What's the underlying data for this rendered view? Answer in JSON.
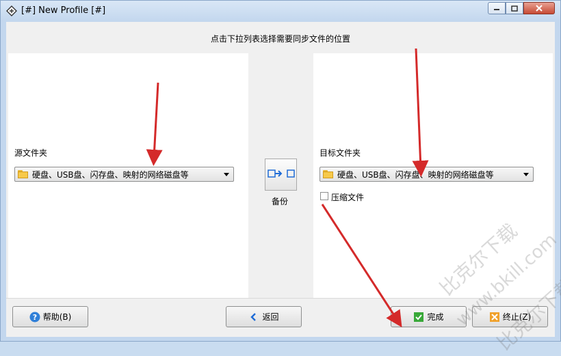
{
  "window": {
    "title": "[#] New Profile [#]"
  },
  "banner": {
    "text": "点击下拉列表选择需要同步文件的位置"
  },
  "source": {
    "label": "源文件夹",
    "combo_value": "硬盘、USB盘、闪存盘、映射的网络磁盘等"
  },
  "middle": {
    "action_label": "备份"
  },
  "target": {
    "label": "目标文件夹",
    "combo_value": "硬盘、USB盘、闪存盘、映射的网络磁盘等",
    "compress_label": "压缩文件",
    "compress_checked": false
  },
  "buttons": {
    "help": "帮助(B)",
    "back": "返回",
    "finish": "完成",
    "cancel": "终止(Z)"
  },
  "watermark": {
    "line1": "比克尔下载",
    "line2": "www.bkill.com",
    "line3": "比克尔下载"
  },
  "colors": {
    "annotation_arrow": "#d42a2a",
    "accent": "#1e6bd6"
  }
}
